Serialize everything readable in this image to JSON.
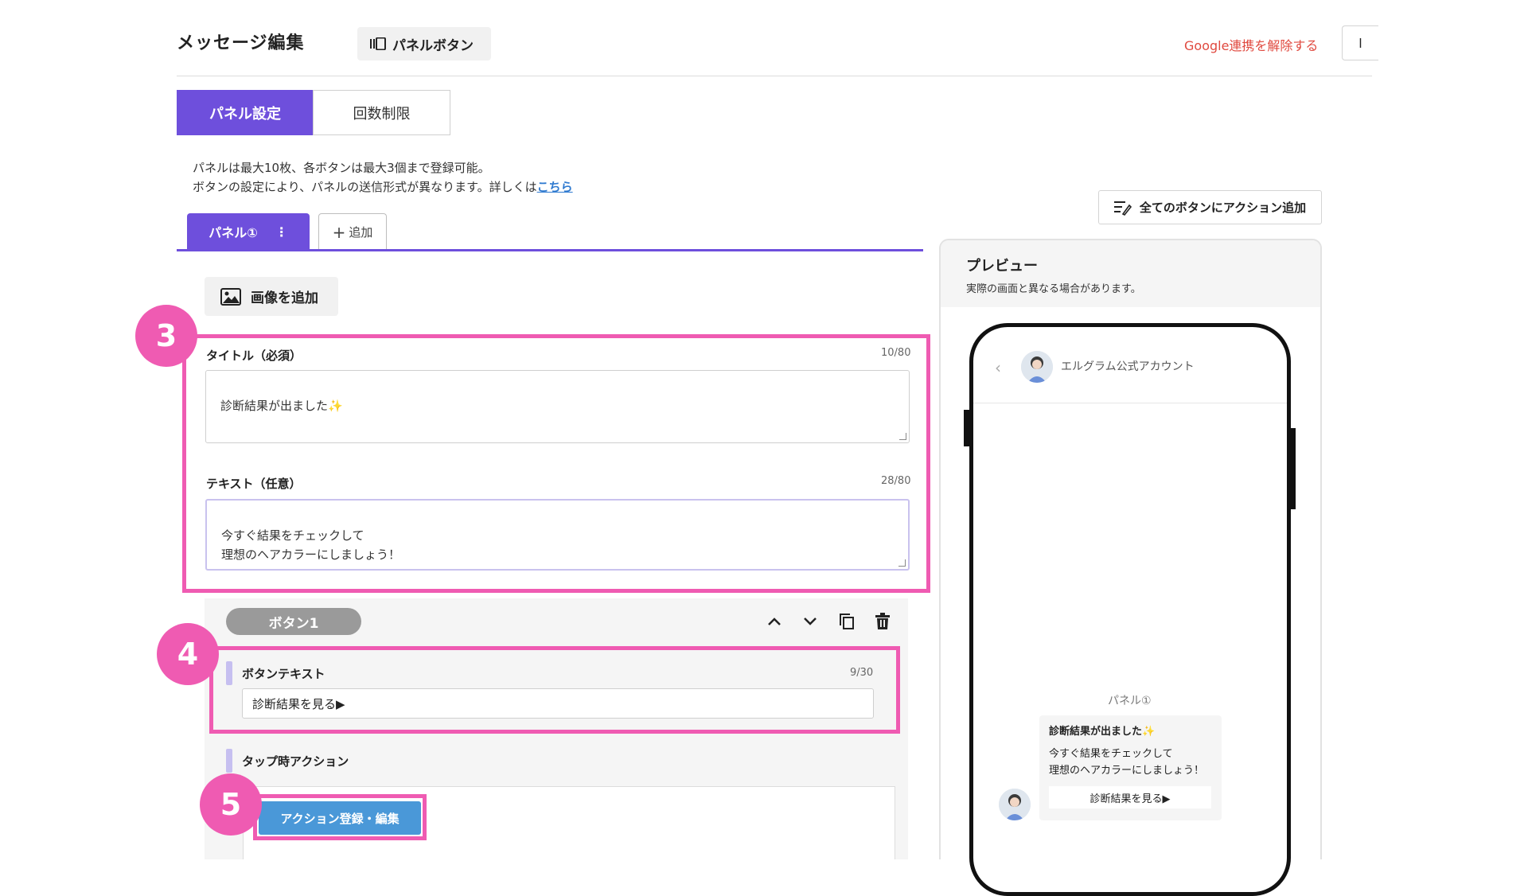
{
  "header": {
    "page_title": "メッセージ編集",
    "panel_button_label": "パネルボタン",
    "google_unlink": "Google連携を解除する",
    "right_button_label": "l"
  },
  "tabs": [
    {
      "label": "パネル設定",
      "active": true
    },
    {
      "label": "回数制限",
      "active": false
    }
  ],
  "note": {
    "line1": "パネルは最大10枚、各ボタンは最大3個まで登録可能。",
    "line2": "ボタンの設定により、パネルの送信形式が異なります。詳しくは",
    "link": "こちら"
  },
  "panel_tabs": {
    "active_label": "パネル①",
    "menu_icon": "⋮",
    "add_label": "追加"
  },
  "add_image_label": "画像を追加",
  "markers": [
    "3",
    "4",
    "5"
  ],
  "title_field": {
    "label": "タイトル（必須）",
    "counter": "10/80",
    "value": "診断結果が出ました"
  },
  "text_field": {
    "label": "テキスト（任意）",
    "counter": "28/80",
    "value": "今すぐ結果をチェックして\n理想のヘアカラーにしましょう！"
  },
  "button1": {
    "pill_label": "ボタン1",
    "text_label": "ボタンテキスト",
    "counter": "9/30",
    "value": "診断結果を見る▶",
    "action_label": "タップ時アクション",
    "action_button": "アクション登録・編集"
  },
  "right": {
    "all_action_button": "全てのボタンにアクション追加",
    "preview_title": "プレビュー",
    "preview_subtitle": "実際の画面と異なる場合があります。",
    "account_name": "エルグラム公式アカウント",
    "panel_label": "パネル①",
    "bubble_title": "診断結果が出ました",
    "bubble_text": "今すぐ結果をチェックして\n理想のヘアカラーにしましょう！",
    "bubble_button": "診断結果を見る▶"
  },
  "colors": {
    "accent_purple": "#6e4fdc",
    "marker_pink": "#ef5bb2",
    "link_blue": "#2f7ad0",
    "action_blue": "#4a98d8",
    "danger_red": "#e0493f"
  }
}
